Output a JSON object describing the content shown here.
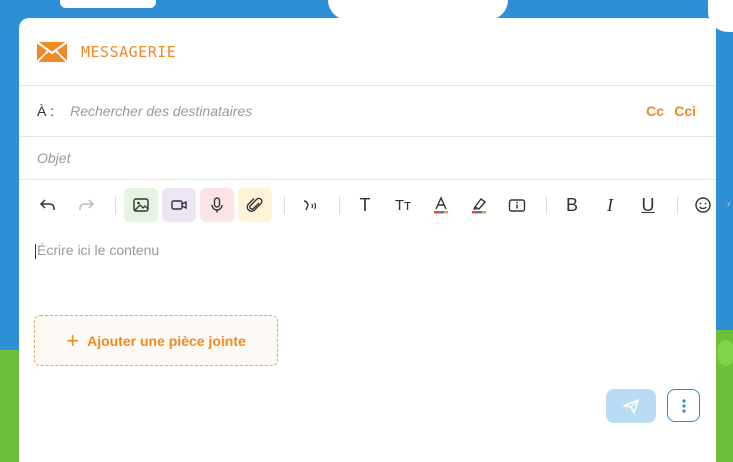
{
  "header": {
    "title": "MESSAGERIE",
    "icon": "envelope-icon",
    "accent": "#f08a24"
  },
  "recipients": {
    "label": "À :",
    "placeholder": "Rechercher des destinataires",
    "cc_label": "Cc",
    "cci_label": "Cci"
  },
  "subject": {
    "placeholder": "Objet"
  },
  "toolbar": {
    "text_label": "T",
    "text_size_label": "Tт",
    "bold_label": "B",
    "italic_label": "I",
    "underline_label": "U"
  },
  "editor": {
    "placeholder": "Écrire ici le contenu"
  },
  "attachment": {
    "plus": "+",
    "label": "Ajouter une pièce jointe"
  },
  "actions": {
    "send_icon": "send-icon",
    "more_icon": "more-vertical-icon"
  }
}
